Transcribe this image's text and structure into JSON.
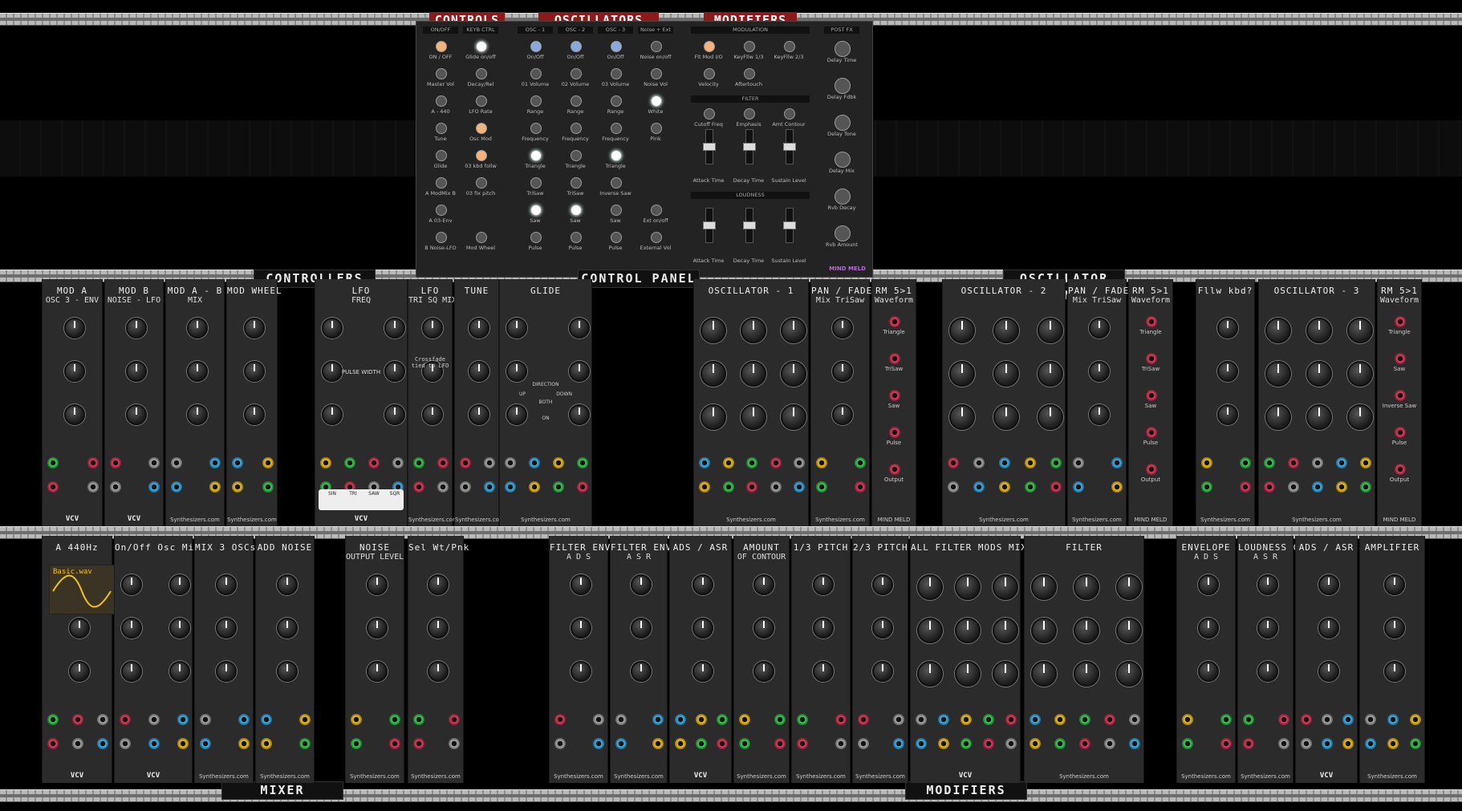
{
  "panel_titles": {
    "controls": "CONTROLS",
    "oscillators": "OSCILLATORS",
    "modifiers": "MODIFIERS"
  },
  "section_labels": {
    "controllers": "CONTROLLERS",
    "control_panel": "CONTROL PANEL",
    "oscillator_bank": "OSCILLATOR BANK",
    "mixer": "MIXER",
    "modifiers": "MODIFIERS"
  },
  "control_panel": {
    "sections": [
      "ON/OFF",
      "KEYB CTRL",
      "OSC - 1",
      "OSC - 2",
      "OSC - 3",
      "Noise + Ext",
      "MODULATION",
      "FILTER",
      "LOUDNESS",
      "POST FX"
    ],
    "col1": [
      "ON / OFF",
      "Master Vol",
      "A - 440",
      "Tune",
      "Glide",
      "A ModMix B",
      "A  03-Env",
      "B  Noise-LFO"
    ],
    "col2": [
      "Glide on/off",
      "Decay/Rel",
      "LFO Rate",
      "Osc Mod",
      "03 kbd follw",
      "03 fix pitch",
      "",
      "Mod Wheel"
    ],
    "osc1": [
      "On/Off",
      "01 Volume",
      "Range",
      "Frequency",
      "Triangle",
      "TriSaw",
      "Saw",
      "Pulse"
    ],
    "osc2": [
      "On/Off",
      "02 Volume",
      "Range",
      "Frequency",
      "Triangle",
      "TriSaw",
      "Saw",
      "Pulse"
    ],
    "osc3": [
      "On/Off",
      "03 Volume",
      "Range",
      "Frequency",
      "Triangle",
      "Inverse Saw",
      "Saw",
      "Pulse"
    ],
    "noise": [
      "Noise on/off",
      "Noise Vol",
      "White",
      "Pink",
      "",
      "",
      "Ext on/off",
      "External Vol"
    ],
    "mod": [
      "Flt Mod I/O",
      "KeyFllw 1/3",
      "KeyFllw 2/3",
      "Velocity",
      "Aftertouch"
    ],
    "filter": [
      "Cutoff Freq",
      "Emphasis",
      "Amt Contour",
      "Attack Time",
      "Decay Time",
      "Sustain Level"
    ],
    "loudness": [
      "Attack Time",
      "Decay Time",
      "Sustain Level"
    ],
    "postfx": [
      "Delay Time",
      "Delay Fdbk",
      "Delay Tone",
      "Delay Mix",
      "Rvb Decay",
      "Rvb Amount"
    ],
    "brand": "MIND MELD"
  },
  "row1_modules": [
    {
      "title": "MOD A",
      "sub": "OSC 3 - ENV",
      "foot": "VCV"
    },
    {
      "title": "MOD B",
      "sub": "NOISE - LFO",
      "foot": "VCV"
    },
    {
      "title": "MOD A - B",
      "sub": "MIX",
      "foot": "Synthesizers.com"
    },
    {
      "title": "MOD WHEEL",
      "sub": "",
      "foot": "Synthesizers.com"
    },
    {
      "title": "LFO",
      "sub": "FREQ",
      "foot": "VCV"
    },
    {
      "title": "LFO",
      "sub": "TRI SQ MIX",
      "foot": "Synthesizers.com"
    },
    {
      "title": "TUNE",
      "sub": "",
      "foot": "Synthesizers.com"
    },
    {
      "title": "GLIDE",
      "sub": "",
      "foot": "Synthesizers.com"
    },
    {
      "title": "OSCILLATOR - 1",
      "sub": "",
      "foot": "Synthesizers.com"
    },
    {
      "title": "PAN / FADE",
      "sub": "Mix TriSaw",
      "foot": "Synthesizers.com"
    },
    {
      "title": "RM 5>1",
      "sub": "Waveform",
      "foot": "MIND MELD"
    },
    {
      "title": "OSCILLATOR - 2",
      "sub": "",
      "foot": "Synthesizers.com"
    },
    {
      "title": "PAN / FADE",
      "sub": "Mix TriSaw",
      "foot": "Synthesizers.com"
    },
    {
      "title": "RM 5>1",
      "sub": "Waveform",
      "foot": "MIND MELD"
    },
    {
      "title": "Fllw kbd?",
      "sub": "",
      "foot": "Synthesizers.com"
    },
    {
      "title": "OSCILLATOR - 3",
      "sub": "",
      "foot": "Synthesizers.com"
    },
    {
      "title": "RM 5>1",
      "sub": "Waveform",
      "foot": "MIND MELD"
    }
  ],
  "rm_labels": [
    "Triangle",
    "TriSaw",
    "Saw",
    "Pulse",
    "Output"
  ],
  "rm3_labels": [
    "Triangle",
    "Saw",
    "Inverse Saw",
    "Pulse",
    "Output"
  ],
  "row2_modules": [
    {
      "title": "A 440Hz",
      "sub": "Basic.wav",
      "foot": "VCV"
    },
    {
      "title": "On/Off Osc Mix",
      "sub": "",
      "foot": "VCV"
    },
    {
      "title": "MIX 3 OSCs",
      "sub": "",
      "foot": "Synthesizers.com"
    },
    {
      "title": "ADD NOISE",
      "sub": "",
      "foot": "Synthesizers.com"
    },
    {
      "title": "NOISE",
      "sub": "OUTPUT LEVEL",
      "foot": "Synthesizers.com"
    },
    {
      "title": "Sel Wt/Pnk",
      "sub": "",
      "foot": "Synthesizers.com"
    },
    {
      "title": "FILTER ENV",
      "sub": "A D S",
      "foot": "Synthesizers.com"
    },
    {
      "title": "FILTER ENV",
      "sub": "A S R",
      "foot": "Synthesizers.com"
    },
    {
      "title": "ADS / ASR",
      "sub": "",
      "foot": "VCV"
    },
    {
      "title": "AMOUNT",
      "sub": "OF CONTOUR",
      "foot": "Synthesizers.com"
    },
    {
      "title": "1/3 PITCH",
      "sub": "",
      "foot": "Synthesizers.com"
    },
    {
      "title": "2/3 PITCH",
      "sub": "",
      "foot": "Synthesizers.com"
    },
    {
      "title": "ALL FILTER MODS MIX",
      "sub": "",
      "foot": "VCV"
    },
    {
      "title": "FILTER",
      "sub": "",
      "foot": "Synthesizers.com"
    },
    {
      "title": "ENVELOPE",
      "sub": "A D S",
      "foot": "Synthesizers.com"
    },
    {
      "title": "LOUDNESS CONTOUR",
      "sub": "A S R",
      "foot": "Synthesizers.com"
    },
    {
      "title": "ADS / ASR",
      "sub": "",
      "foot": "VCV"
    },
    {
      "title": "AMPLIFIER",
      "sub": "",
      "foot": "Synthesizers.com"
    }
  ],
  "lfo_labels": {
    "pulse_width": "PULSE WIDTH",
    "crossfade": "Crossfade tied to LFO",
    "buttons": [
      "SIN",
      "TRI",
      "SAW",
      "SQR"
    ]
  },
  "glide_labels": {
    "direction": "DIRECTION",
    "up": "UP",
    "down": "DOWN",
    "both": "BOTH",
    "on": "ON"
  }
}
